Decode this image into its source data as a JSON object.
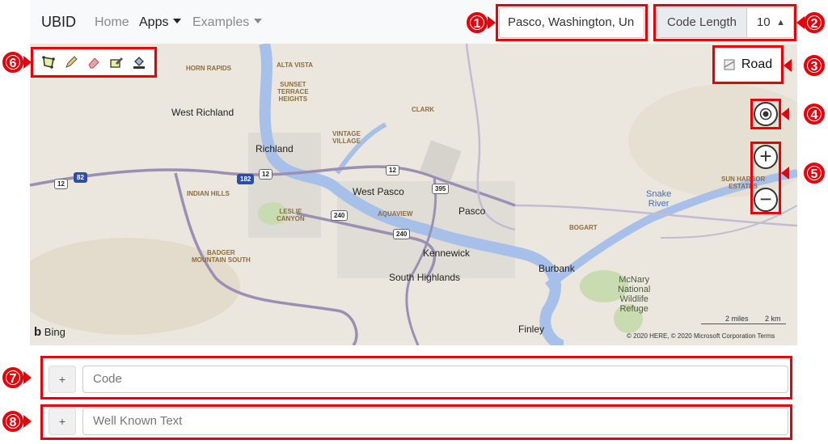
{
  "navbar": {
    "brand": "UBID",
    "links": [
      {
        "label": "Home"
      },
      {
        "label": "Apps"
      },
      {
        "label": "Examples"
      }
    ],
    "search_value": "Pasco, Washington, Un",
    "code_length_label": "Code Length",
    "code_length_value": "10"
  },
  "map": {
    "style_button": "Road",
    "labels": {
      "west_richland": "West Richland",
      "richland": "Richland",
      "west_pasco": "West Pasco",
      "pasco": "Pasco",
      "kennewick": "Kennewick",
      "south_highlands": "South Highlands",
      "burbank": "Burbank",
      "finley": "Finley",
      "horn_rapids": "HORN RAPIDS",
      "alta_vista": "ALTA VISTA",
      "sunset": "SUNSET\nTERRACE\nHEIGHTS",
      "clark": "CLARK",
      "vintage": "VINTAGE\nVILLAGE",
      "indian_hills": "INDIAN HILLS",
      "leslie": "LESLIE\nCANYON",
      "aquaview": "AQUAVIEW",
      "badger": "BADGER\nMOUNTAIN SOUTH",
      "bogart": "BOGART",
      "sun_harbor": "SUN HARBOR\nESTATES",
      "snake_river": "Snake\nRiver",
      "mcnary": "McNary\nNational\nWildlife\nRefuge"
    },
    "shields": [
      "12",
      "82",
      "182",
      "12",
      "12",
      "395",
      "240",
      "240"
    ],
    "bing_label": "Bing",
    "scale_miles": "2 miles",
    "scale_km": "2 km",
    "copyright": "© 2020 HERE, © 2020 Microsoft Corporation  Terms"
  },
  "inputs": {
    "plus_label": "+",
    "code_placeholder": "Code",
    "wkt_placeholder": "Well Known Text"
  },
  "callouts": [
    "1",
    "2",
    "3",
    "4",
    "5",
    "6",
    "7",
    "8"
  ],
  "colors": {
    "callout_red": "#e8000b",
    "water": "#a7c0ea",
    "road": "#9c8fb4"
  }
}
